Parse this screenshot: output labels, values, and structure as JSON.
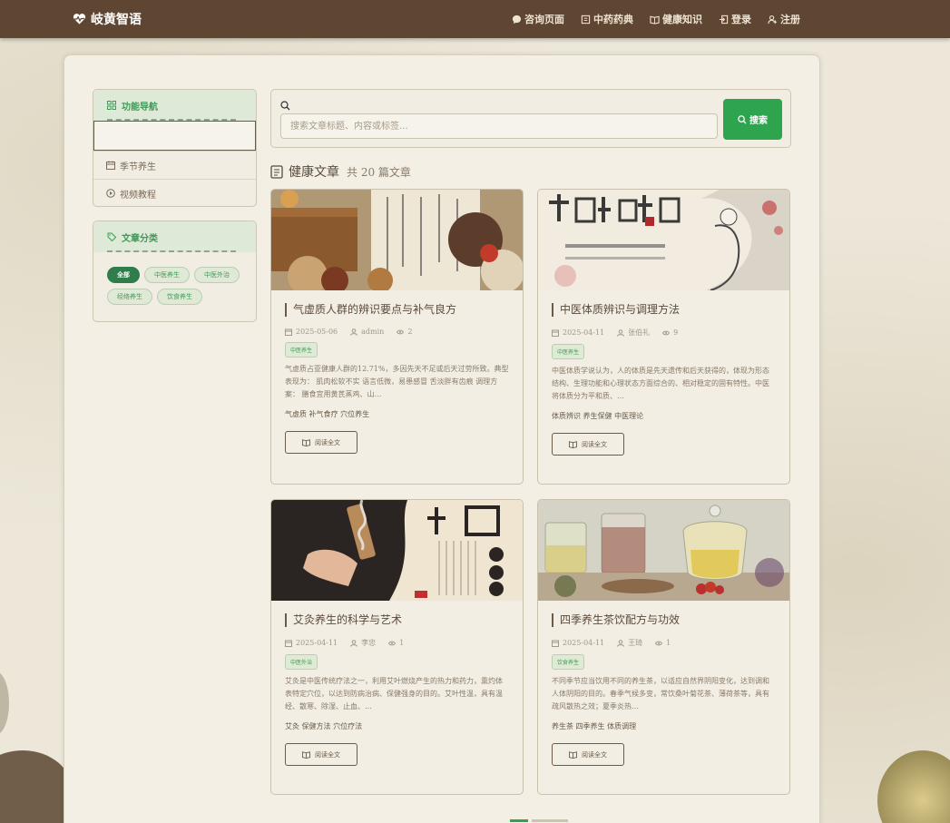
{
  "brand": {
    "name": "岐黄智语"
  },
  "nav": {
    "consult": "咨询页面",
    "herbs": "中药药典",
    "knowledge": "健康知识",
    "login": "登录",
    "register": "注册"
  },
  "sidebar": {
    "nav_title": "功能导航",
    "nav_items": [
      {
        "label": "季节养生",
        "icon": "calendar-icon"
      },
      {
        "label": "视频教程",
        "icon": "play-icon"
      }
    ],
    "cat_title": "文章分类",
    "categories": [
      {
        "label": "全部",
        "active": true
      },
      {
        "label": "中医养生",
        "active": false
      },
      {
        "label": "中医外治",
        "active": false
      },
      {
        "label": "经络养生",
        "active": false
      },
      {
        "label": "饮食养生",
        "active": false
      }
    ]
  },
  "search": {
    "placeholder": "搜索文章标题、内容或标签...",
    "button": "搜索"
  },
  "section": {
    "title": "健康文章",
    "count": "共 20 篇文章"
  },
  "articles": [
    {
      "title": "气虚质人群的辨识要点与补气良方",
      "date": "2025-05-06",
      "author": "admin",
      "views": "2",
      "tag": "中医养生",
      "excerpt": "气虚质占亚健康人群的12.71%，多因先天不足或后天过劳所致。典型表现为： 肌肉松软不实 语言低微，易患感冒 舌淡胖有齿痕 调理方案： 膳食宜用黄芪蒸鸡、山…",
      "keywords": "气虚质 补气食疗 穴位养生",
      "read": "阅读全文",
      "image": "herbs-scroll"
    },
    {
      "title": "中医体质辨识与调理方法",
      "date": "2025-04-11",
      "author": "张伯礼",
      "views": "9",
      "tag": "中医养生",
      "excerpt": "中医体质学说认为，人的体质是先天遗传和后天获得的，体现为形态结构、生理功能和心理状态方面综合的、相对稳定的固有特性。中医将体质分为平和质、…",
      "keywords": "体质辨识 养生保健 中医理论",
      "read": "阅读全文",
      "image": "tcm-calligraphy"
    },
    {
      "title": "艾灸养生的科学与艺术",
      "date": "2025-04-11",
      "author": "李忠",
      "views": "1",
      "tag": "中医外治",
      "excerpt": "艾灸是中医传统疗法之一，利用艾叶燃烧产生的热力和药力，熏灼体表特定穴位，以达到防病治病、保健强身的目的。艾叶性温，具有温经、散寒、除湿、止血、…",
      "keywords": "艾灸 保健方法 穴位疗法",
      "read": "阅读全文",
      "image": "moxibustion"
    },
    {
      "title": "四季养生茶饮配方与功效",
      "date": "2025-04-11",
      "author": "王琦",
      "views": "1",
      "tag": "饮食养生",
      "excerpt": "不同季节应当饮用不同的养生茶，以适应自然界阴阳变化，达到调和人体阴阳的目的。春季气候多变，常饮桑叶菊花茶、薄荷茶等，具有疏风散热之效；夏季炎热…",
      "keywords": "养生茶 四季养生 体质调理",
      "read": "阅读全文",
      "image": "herbal-tea"
    }
  ],
  "colors": {
    "navbar": "#5e4632",
    "accent_green": "#2ea44f",
    "active_pill": "#2e7d4a"
  }
}
